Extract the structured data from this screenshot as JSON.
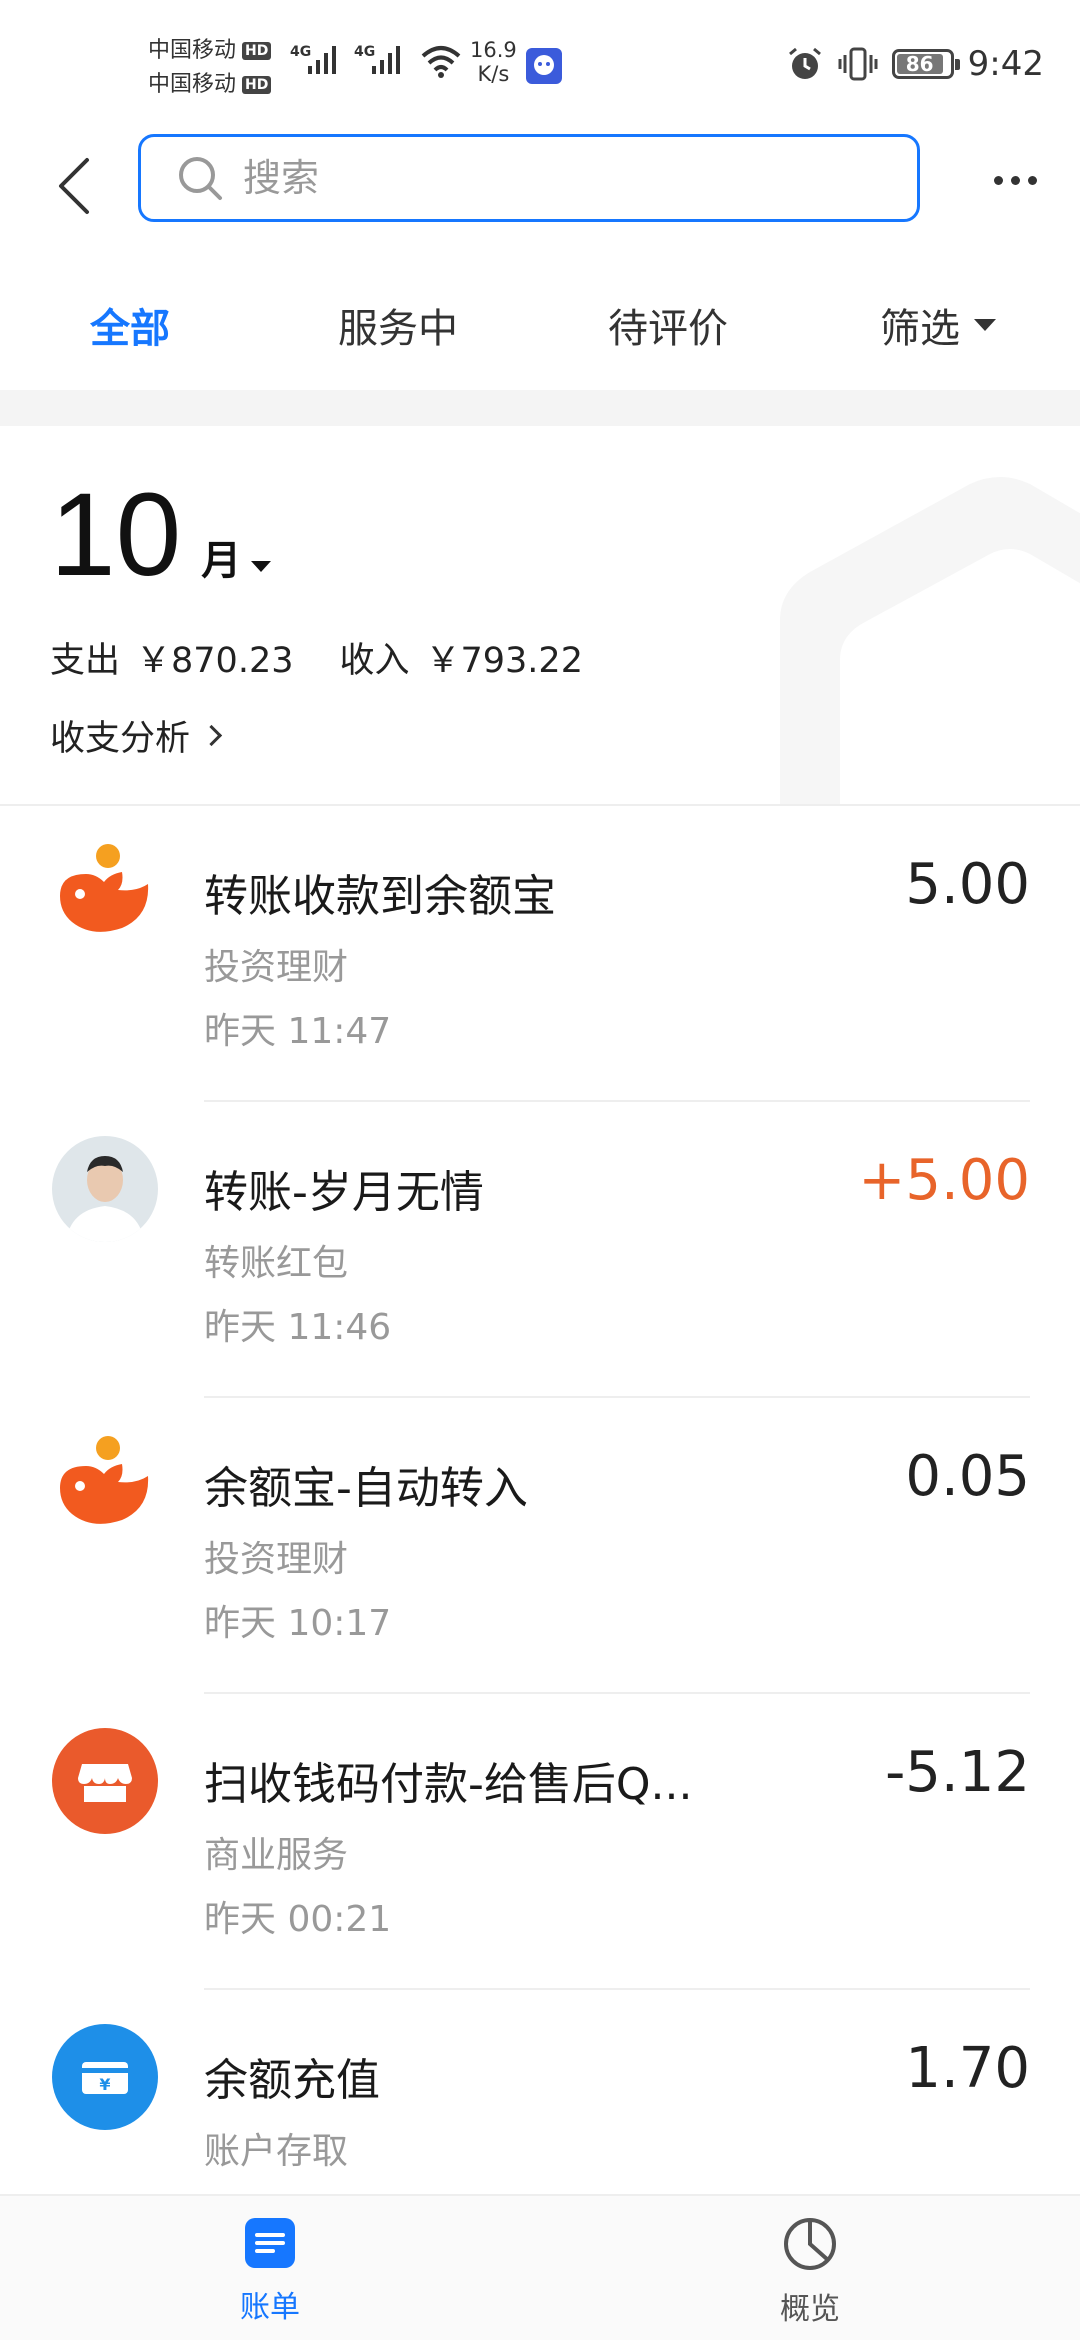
{
  "status_bar": {
    "carrier_1": "中国移动",
    "carrier_2": "中国移动",
    "hd": "HD",
    "network_1": "4G",
    "network_2": "4G",
    "speed_value": "16.9",
    "speed_unit": "K/s",
    "battery": "86",
    "time": "9:42"
  },
  "header": {
    "search_placeholder": "搜索"
  },
  "tabs": [
    {
      "label": "全部",
      "active": true
    },
    {
      "label": "服务中",
      "active": false
    },
    {
      "label": "待评价",
      "active": false
    },
    {
      "label": "筛选",
      "active": false
    }
  ],
  "summary": {
    "month": "10",
    "month_unit": "月",
    "expense_label": "支出",
    "expense_amount": "￥870.23",
    "income_label": "收入",
    "income_amount": "￥793.22",
    "analysis_link": "收支分析"
  },
  "transactions": [
    {
      "title": "转账收款到余额宝",
      "category": "投资理财",
      "time": "昨天  11:47",
      "amount": "5.00",
      "icon": "yuebao-icon"
    },
    {
      "title": "转账-岁月无情",
      "category": "转账红包",
      "time": "昨天  11:46",
      "amount": "+5.00",
      "icon": "user-avatar"
    },
    {
      "title": "余额宝-自动转入",
      "category": "投资理财",
      "time": "昨天  10:17",
      "amount": "0.05",
      "icon": "yuebao-icon"
    },
    {
      "title": "扫收钱码付款-给售后Q...",
      "category": "商业服务",
      "time": "昨天  00:21",
      "amount": "-5.12",
      "icon": "store-icon"
    },
    {
      "title": "余额充值",
      "category": "账户存取",
      "time": "",
      "amount": "1.70",
      "icon": "wallet-icon"
    }
  ],
  "bottom_nav": {
    "bill_label": "账单",
    "overview_label": "概览"
  },
  "colors": {
    "accent": "#1677ff",
    "positive_amount": "#e8642a",
    "yuebao_orange": "#f25a1f"
  }
}
